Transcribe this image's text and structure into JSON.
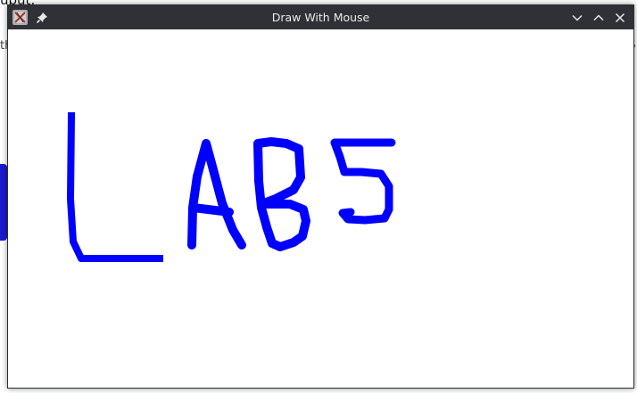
{
  "background_app": {
    "top_text": "ubut:",
    "left_text": "th",
    "right_glyph": "❯",
    "accent_color": "#1a1acc"
  },
  "window": {
    "title": "Draw With Mouse",
    "titlebar_color": "#2f3136",
    "buttons": {
      "minimize": "chevron-down-icon",
      "maximize": "chevron-up-icon",
      "close": "close-icon"
    }
  },
  "canvas": {
    "stroke_color": "#0000ff",
    "drawn_text": "LAB5"
  }
}
